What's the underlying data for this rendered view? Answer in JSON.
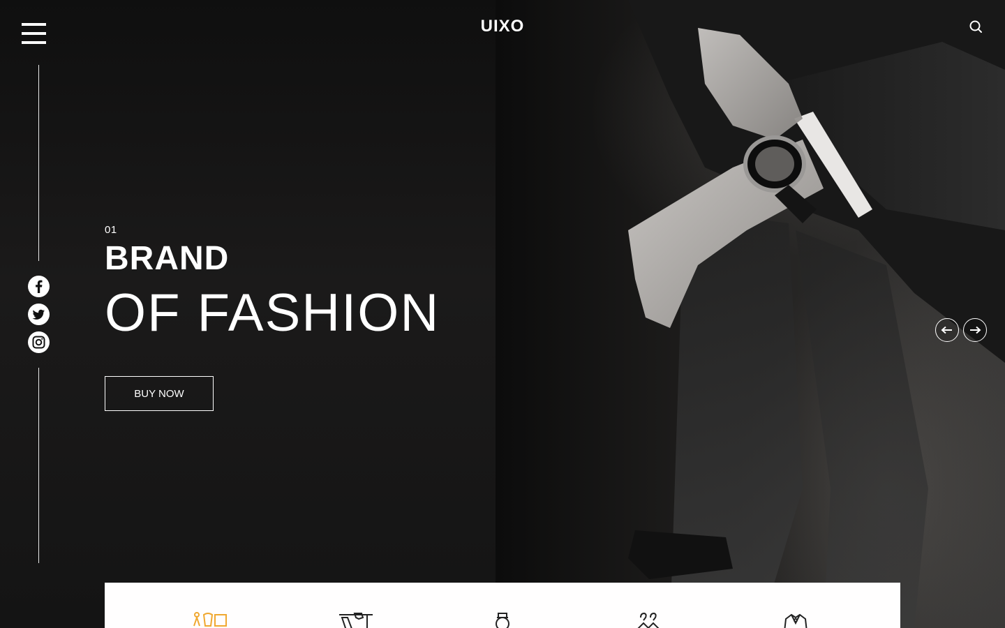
{
  "header": {
    "logo": "UIXO",
    "menu_icon": "hamburger-menu-icon",
    "search_icon": "search-icon"
  },
  "social": [
    {
      "name": "facebook",
      "icon": "facebook-icon"
    },
    {
      "name": "twitter",
      "icon": "twitter-icon"
    },
    {
      "name": "instagram",
      "icon": "instagram-icon"
    }
  ],
  "hero": {
    "slide_number": "01",
    "title_line1": "BRAND",
    "title_line2": "OF FASHION",
    "cta_label": "BUY NOW",
    "image": "man-adjusting-watch-suit-photo"
  },
  "slider": {
    "prev_icon": "arrow-left-icon",
    "next_icon": "arrow-right-icon"
  },
  "categories": [
    {
      "icon": "dresses-icon",
      "active": true
    },
    {
      "icon": "shirts-icon",
      "active": false
    },
    {
      "icon": "perfume-icon",
      "active": false
    },
    {
      "icon": "hangers-icon",
      "active": false
    },
    {
      "icon": "blazer-icon",
      "active": false
    }
  ],
  "colors": {
    "background": "#111111",
    "text": "#ffffff",
    "accent": "#f0a830",
    "panel": "#fffefe"
  }
}
